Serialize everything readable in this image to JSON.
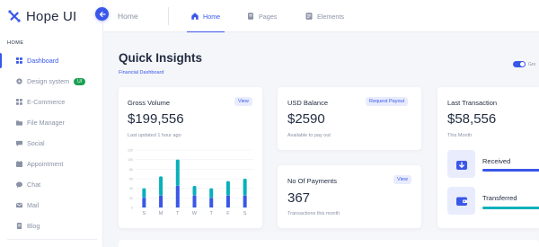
{
  "brand": {
    "name": "Hope UI"
  },
  "sidebar": {
    "section_title": "HOME",
    "items": [
      {
        "label": "Dashboard",
        "icon": "grid-icon"
      },
      {
        "label": "Design system",
        "icon": "design-icon",
        "badge": "UI"
      },
      {
        "label": "E-Commerce",
        "icon": "cart-icon"
      },
      {
        "label": "File Manager",
        "icon": "folder-icon"
      },
      {
        "label": "Social",
        "icon": "social-icon"
      },
      {
        "label": "Appointment",
        "icon": "calendar-icon"
      },
      {
        "label": "Chat",
        "icon": "chat-icon"
      },
      {
        "label": "Mail",
        "icon": "mail-icon"
      },
      {
        "label": "Blog",
        "icon": "blog-icon"
      }
    ]
  },
  "topbar": {
    "breadcrumb": "Home",
    "tabs": [
      {
        "label": "Home",
        "icon": "home-icon",
        "active": true
      },
      {
        "label": "Pages",
        "icon": "pages-icon",
        "active": false
      },
      {
        "label": "Elements",
        "icon": "elements-icon",
        "active": false
      }
    ]
  },
  "main": {
    "title": "Quick Insights",
    "subtitle": "Financial Dashboard",
    "toggle_label": "Gro"
  },
  "gross_volume": {
    "title": "Gross Volume",
    "pill": "View",
    "value": "$199,556",
    "note": "Last updated 1 hour ago"
  },
  "usd_balance": {
    "title": "USD Balance",
    "pill": "Request Payout",
    "value": "$2590",
    "note": "Available to pay out"
  },
  "payments": {
    "title": "No Of Payments",
    "pill": "View",
    "value": "367",
    "note": "Transactions this month"
  },
  "last_transaction": {
    "title": "Last Transaction",
    "value": "$58,556",
    "note": "This Month",
    "rows": [
      {
        "label": "Received",
        "icon": "download-icon",
        "color": "#3a57e8",
        "progress": 0.7
      },
      {
        "label": "Transferred",
        "icon": "wallet-icon",
        "color": "#08b1ba",
        "progress": 0.7
      }
    ]
  },
  "colors": {
    "primary": "#3a57e8",
    "secondary": "#08b1ba",
    "success": "#1aa053"
  },
  "chart_data": {
    "type": "bar",
    "stacked": true,
    "categories": [
      "S",
      "M",
      "T",
      "W",
      "T",
      "F",
      "S"
    ],
    "yticks": [
      "0",
      "20",
      "40",
      "60",
      "80",
      "100",
      "120"
    ],
    "ylim": [
      0,
      120
    ],
    "series": [
      {
        "values": [
          20,
          25,
          45,
          25,
          20,
          25,
          25
        ],
        "color": "#3a57e8"
      },
      {
        "values": [
          20,
          40,
          55,
          20,
          20,
          30,
          35
        ],
        "color": "#08b1ba"
      }
    ]
  }
}
